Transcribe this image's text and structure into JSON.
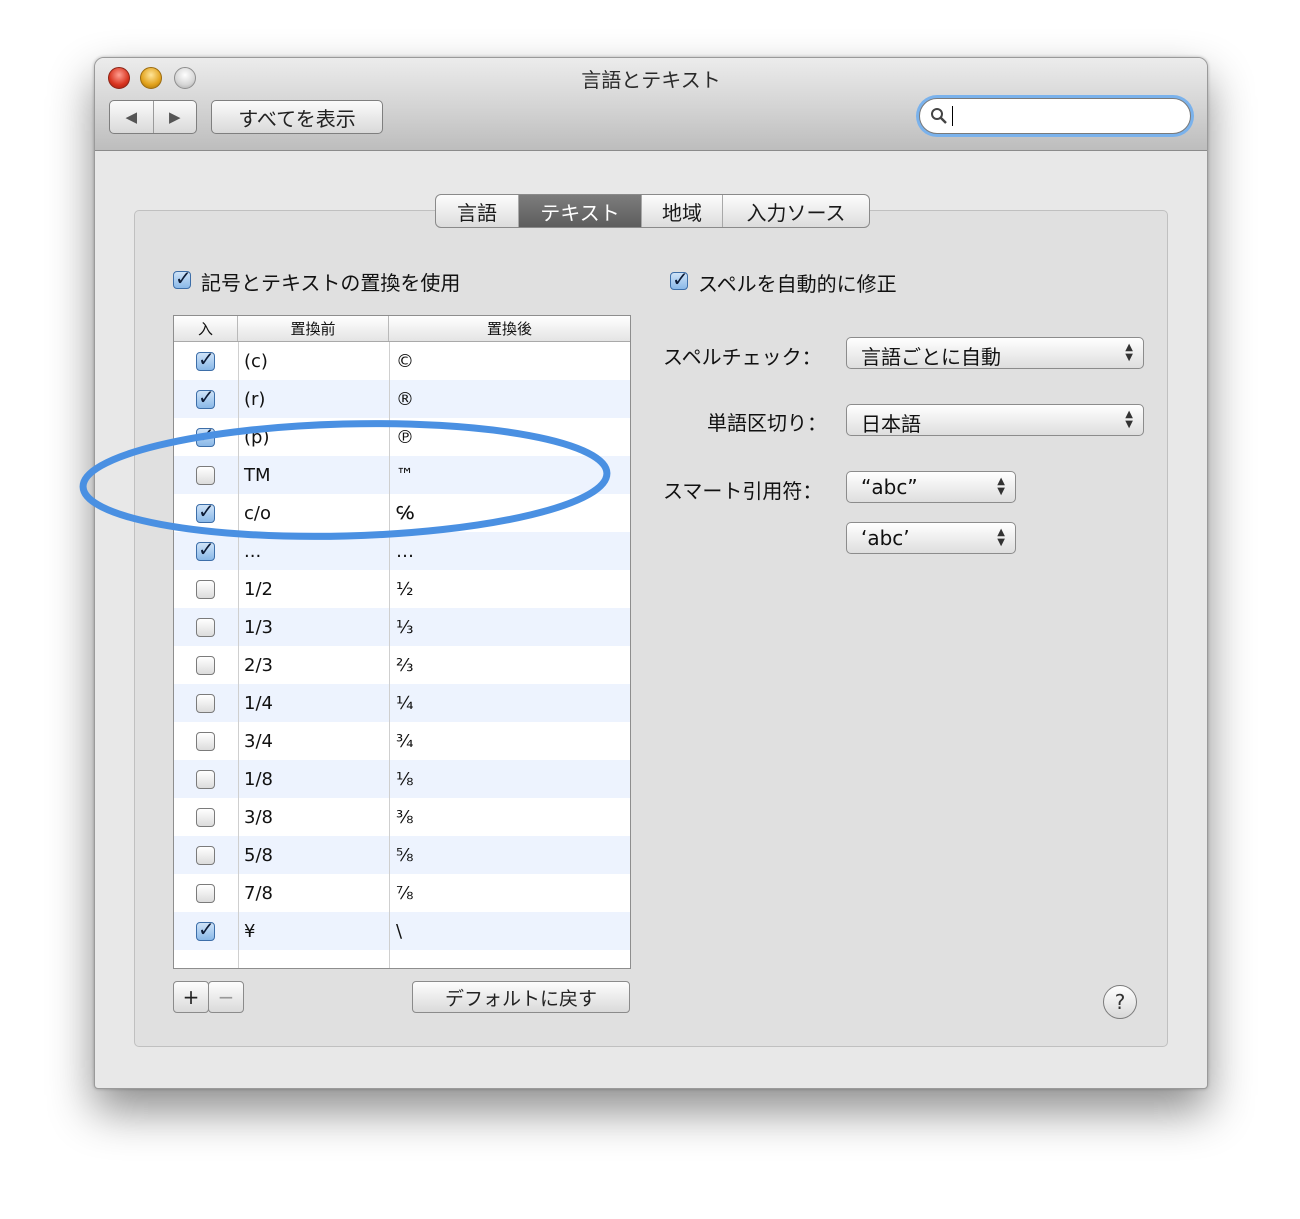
{
  "window": {
    "title": "言語とテキスト"
  },
  "toolbar": {
    "back_icon": "◀",
    "forward_icon": "▶",
    "show_all": "すべてを表示",
    "search_icon": "magnifier-icon",
    "search_value": ""
  },
  "tabs": [
    {
      "label": "言語",
      "active": false
    },
    {
      "label": "テキスト",
      "active": true
    },
    {
      "label": "地域",
      "active": false
    },
    {
      "label": "入力ソース",
      "active": false
    }
  ],
  "left": {
    "use_replacement_label": "記号とテキストの置換を使用",
    "use_replacement_checked": true,
    "table": {
      "headers": [
        "入",
        "置換前",
        "置換後"
      ],
      "rows": [
        {
          "on": true,
          "replace": "(c)",
          "with": "©"
        },
        {
          "on": true,
          "replace": "(r)",
          "with": "®"
        },
        {
          "on": true,
          "replace": "(p)",
          "with": "℗"
        },
        {
          "on": false,
          "replace": "TM",
          "with": "™"
        },
        {
          "on": true,
          "replace": "c/o",
          "with": "℅"
        },
        {
          "on": true,
          "replace": "...",
          "with": "…"
        },
        {
          "on": false,
          "replace": "1/2",
          "with": "½"
        },
        {
          "on": false,
          "replace": "1/3",
          "with": "⅓"
        },
        {
          "on": false,
          "replace": "2/3",
          "with": "⅔"
        },
        {
          "on": false,
          "replace": "1/4",
          "with": "¼"
        },
        {
          "on": false,
          "replace": "3/4",
          "with": "¾"
        },
        {
          "on": false,
          "replace": "1/8",
          "with": "⅛"
        },
        {
          "on": false,
          "replace": "3/8",
          "with": "⅜"
        },
        {
          "on": false,
          "replace": "5/8",
          "with": "⅝"
        },
        {
          "on": false,
          "replace": "7/8",
          "with": "⅞"
        },
        {
          "on": true,
          "replace": "¥",
          "with": "\\"
        }
      ]
    },
    "add_label": "+",
    "remove_label": "−",
    "restore_default": "デフォルトに戻す"
  },
  "right": {
    "auto_spell_label": "スペルを自動的に修正",
    "auto_spell_checked": true,
    "spellcheck_label": "スペルチェック：",
    "spellcheck_value": "言語ごとに自動",
    "word_break_label": "単語区切り：",
    "word_break_value": "日本語",
    "smart_quotes_label": "スマート引用符：",
    "double_quote_value": "“abc”",
    "single_quote_value": "‘abc’"
  },
  "help_label": "?",
  "annotation": {
    "color": "#4a90e2"
  }
}
